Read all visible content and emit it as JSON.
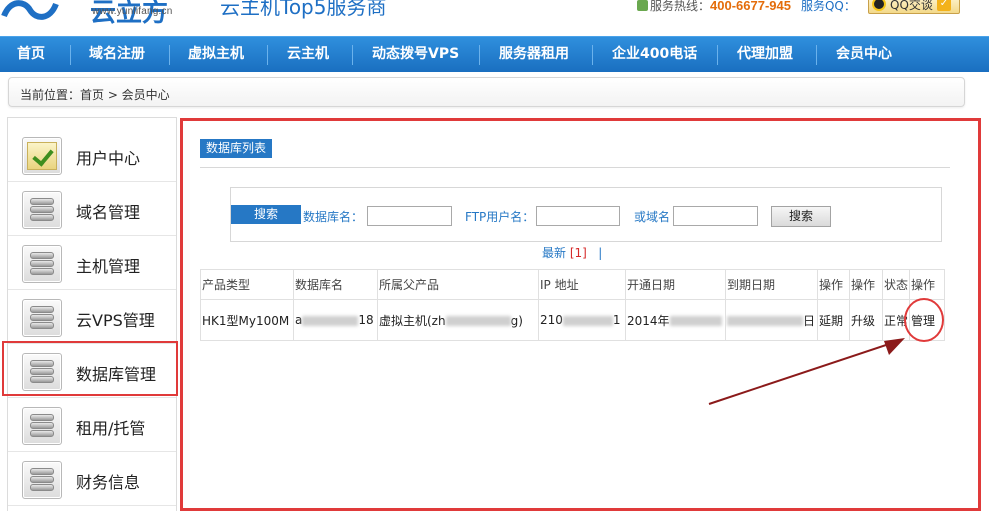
{
  "header": {
    "logo_cn": "云立方",
    "logo_url": "www.yunlifang.cn",
    "slogan": "云主机Top5服务商",
    "hotline_label": "服务热线：",
    "hotline_number": "400-6677-945",
    "qq_label": "服务QQ：",
    "qq_button": "QQ交谈"
  },
  "nav": {
    "items": [
      "首页",
      "域名注册",
      "虚拟主机",
      "云主机",
      "动态拨号VPS",
      "服务器租用",
      "企业400电话",
      "代理加盟",
      "会员中心"
    ]
  },
  "breadcrumb": {
    "text": "当前位置：首页 > 会员中心"
  },
  "sidebar": {
    "items": [
      {
        "label": "用户中心"
      },
      {
        "label": "域名管理"
      },
      {
        "label": "主机管理"
      },
      {
        "label": "云VPS管理"
      },
      {
        "label": "数据库管理"
      },
      {
        "label": "租用/托管"
      },
      {
        "label": "财务信息"
      }
    ]
  },
  "main": {
    "title": "数据库列表",
    "search": {
      "tag": "搜索",
      "db_label": "数据库名：",
      "ftp_label": "FTP用户名：",
      "domain_label": "或域名",
      "button": "搜索",
      "db_value": "",
      "ftp_value": "",
      "domain_value": ""
    },
    "pager": {
      "latest": "最新",
      "current": "[1]",
      "sep": "|"
    },
    "table": {
      "headers": [
        "产品类型",
        "数据库名",
        "所属父产品",
        "IP 地址",
        "开通日期",
        "到期日期",
        "操作",
        "操作",
        "状态",
        "操作"
      ],
      "row": {
        "type": "HK1型My100M",
        "db_prefix": "a",
        "db_suffix": "18",
        "parent_prefix": "虚拟主机(zh",
        "parent_suffix": "g)",
        "ip_prefix": "210",
        "ip_suffix": "1",
        "open_prefix": "2014年",
        "expire_suffix": "日",
        "renew": "延期",
        "upgrade": "升级",
        "status": "正常",
        "manage": "管理"
      }
    }
  },
  "colors": {
    "nav_blue": "#1a6fc0",
    "accent_blue": "#2678c5",
    "highlight_red": "#e03a3a",
    "arrow_red": "#8b1a1a",
    "phone_orange": "#e46c0a"
  }
}
